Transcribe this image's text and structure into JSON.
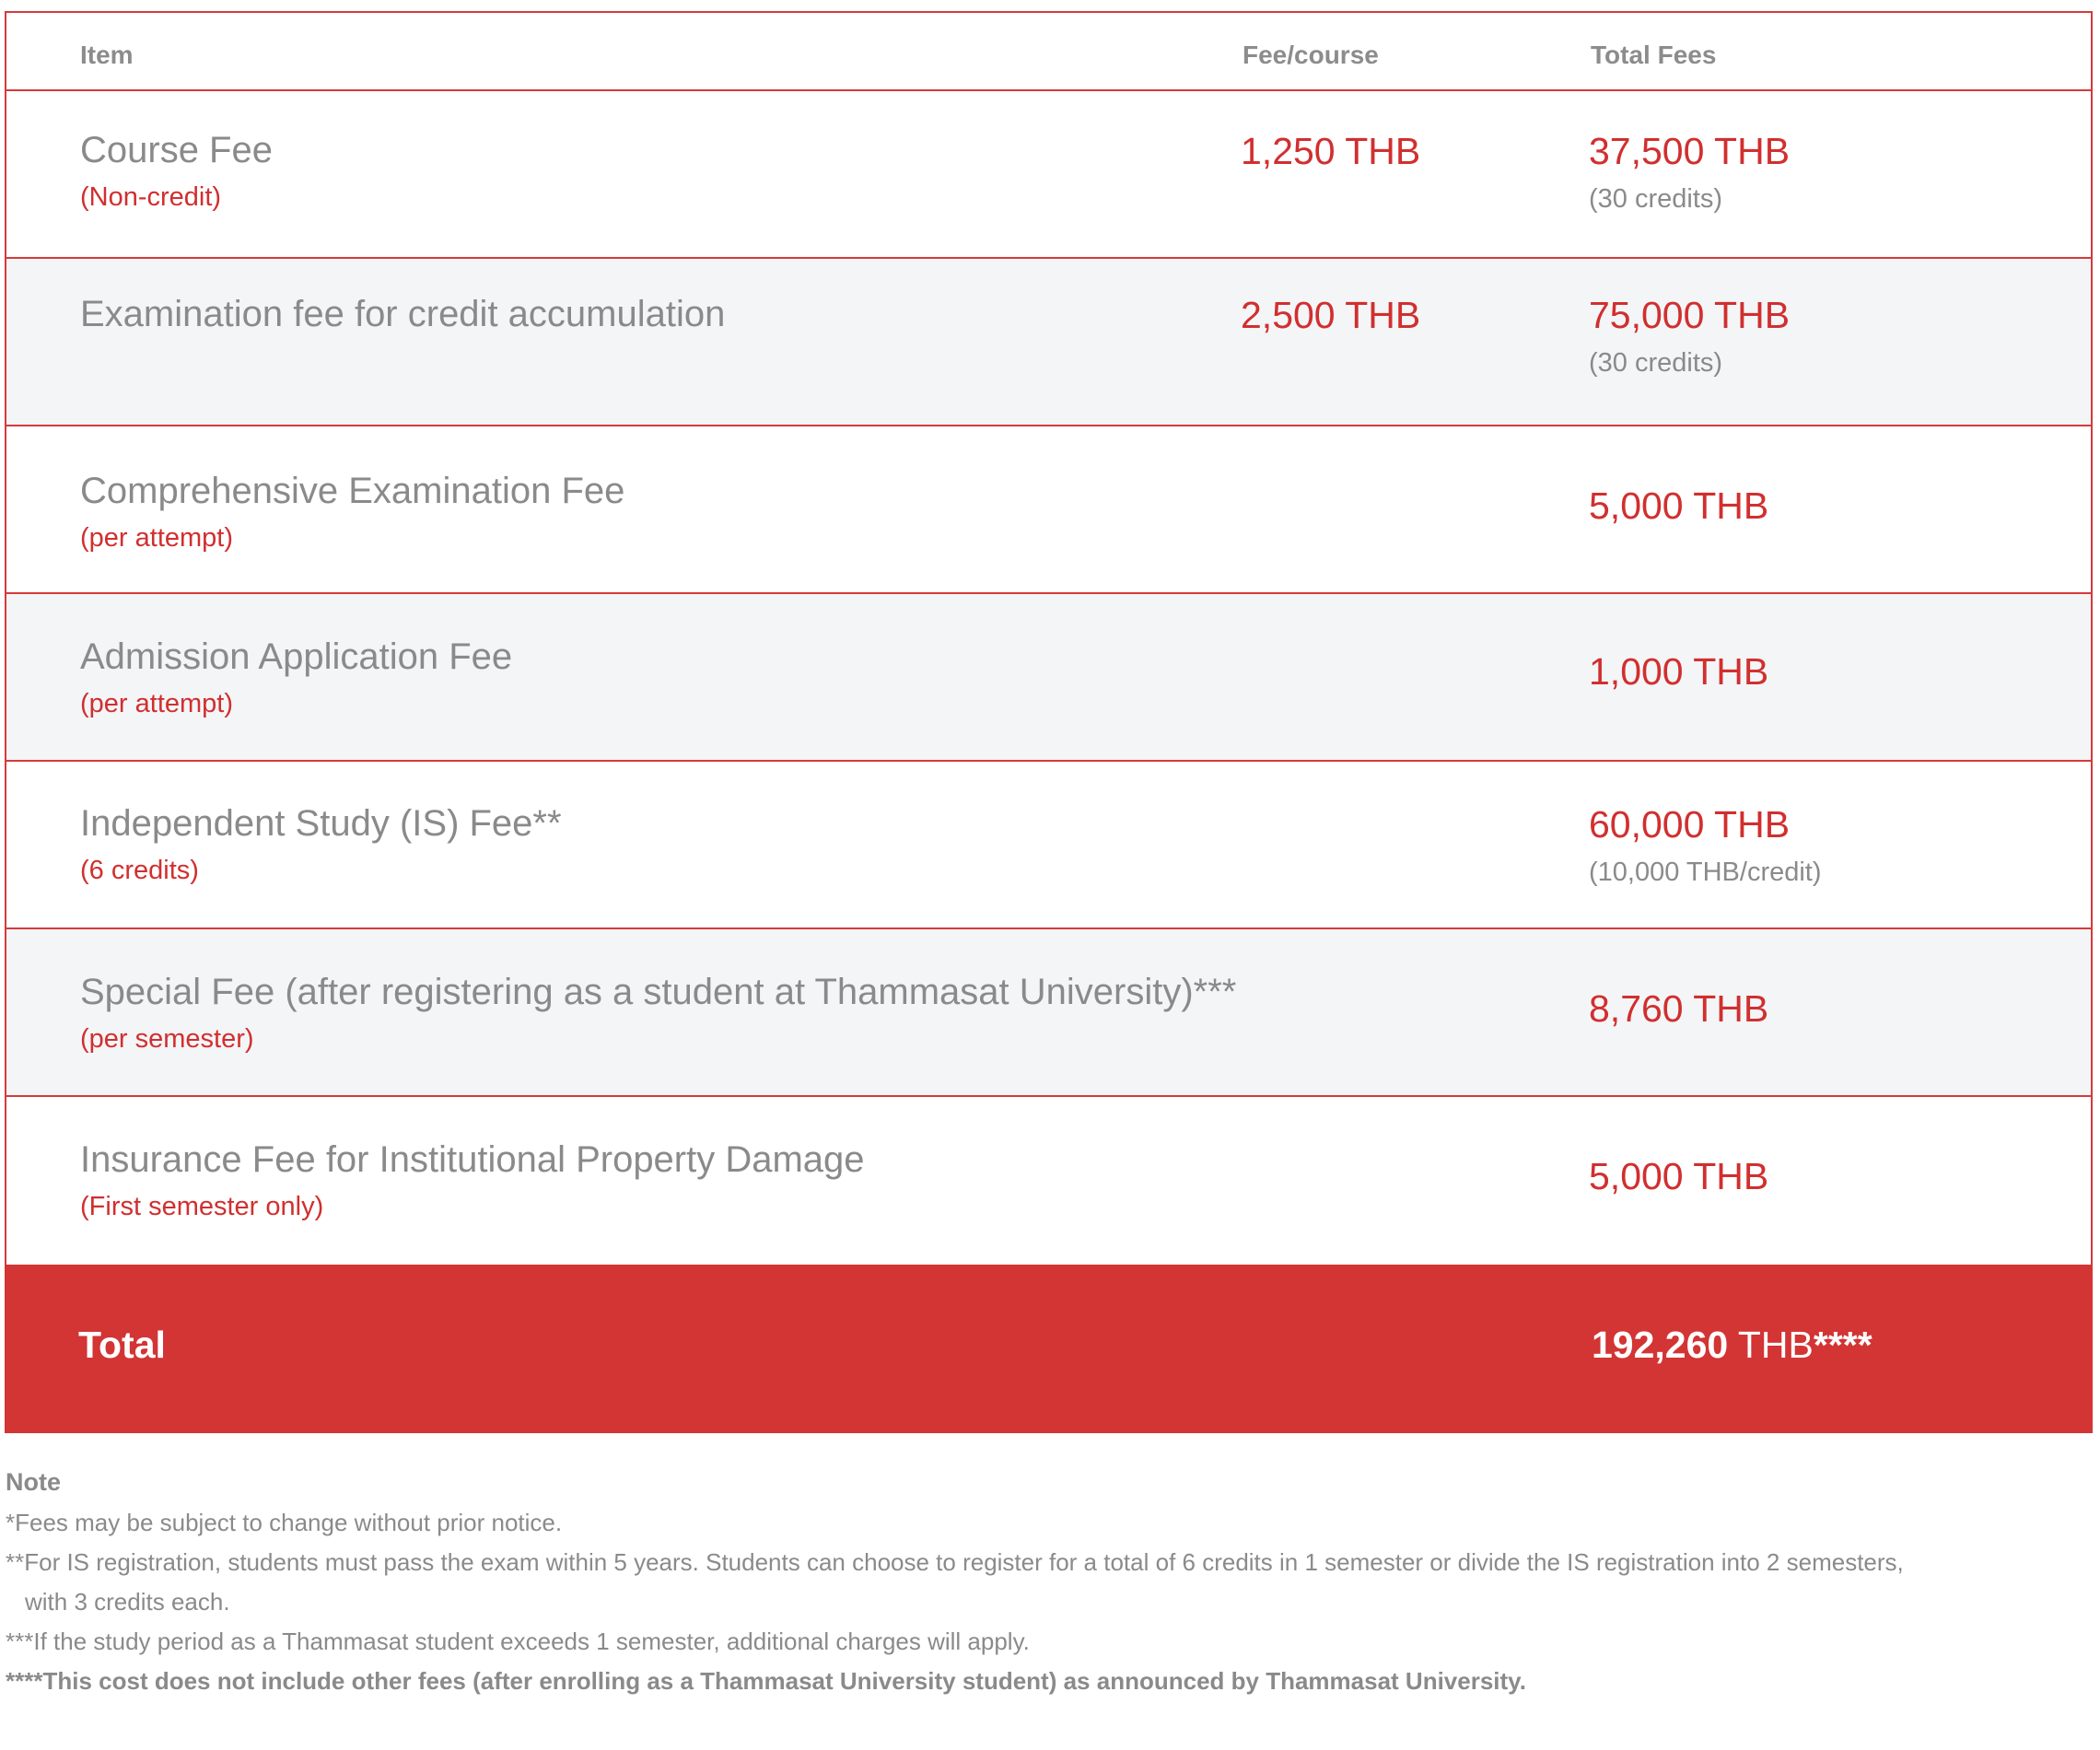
{
  "table": {
    "headers": {
      "item": "Item",
      "fee": "Fee/course",
      "total": "Total Fees"
    },
    "rows": [
      {
        "title": "Course Fee",
        "subtitle": "(Non-credit)",
        "fee": "1,250 THB",
        "total": "37,500 THB",
        "total_note": "(30 credits)"
      },
      {
        "title": "Examination fee for credit accumulation",
        "subtitle": "",
        "fee": "2,500 THB",
        "total": "75,000 THB",
        "total_note": "(30 credits)"
      },
      {
        "title": "Comprehensive Examination Fee",
        "subtitle": "(per attempt)",
        "fee": "",
        "total": "5,000 THB",
        "total_note": ""
      },
      {
        "title": "Admission Application Fee",
        "subtitle": "(per attempt)",
        "fee": "",
        "total": "1,000 THB",
        "total_note": ""
      },
      {
        "title": "Independent Study (IS) Fee**",
        "subtitle": "(6 credits)",
        "fee": "",
        "total": "60,000 THB",
        "total_note": "(10,000 THB/credit)"
      },
      {
        "title": "Special Fee (after registering as a student at Thammasat University)***",
        "subtitle": "(per semester)",
        "fee": "",
        "total": "8,760 THB",
        "total_note": ""
      },
      {
        "title": "Insurance Fee for Institutional Property Damage",
        "subtitle": "(First semester only)",
        "fee": "",
        "total": "5,000 THB",
        "total_note": ""
      }
    ],
    "total": {
      "label": "Total",
      "amount": "192,260",
      "currency": "THB",
      "marker": "****"
    }
  },
  "notes": {
    "heading": "Note",
    "line1": "*Fees may be subject to change without prior notice.",
    "line2": "**For IS registration, students must pass the exam within 5 years. Students can choose to register for a total of 6 credits in 1 semester or divide the IS registration into 2 semesters,",
    "line2_cont": "with 3 credits each.",
    "line3": "***If the study period as a Thammasat student exceeds 1 semester, additional charges will apply.",
    "line4": "****This cost does not include other fees (after enrolling as a Thammasat University student) as announced by Thammasat University."
  },
  "colors": {
    "accent": "#d33434",
    "text_gray": "#8a8a8a",
    "row_alt": "#f4f5f7"
  }
}
